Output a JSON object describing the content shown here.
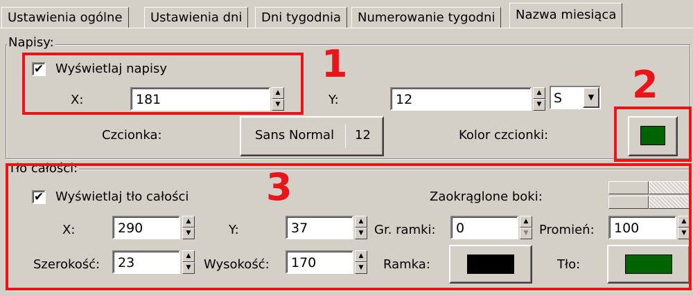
{
  "tabs": [
    {
      "label": "Ustawienia ogólne",
      "active": false
    },
    {
      "label": "Ustawienia dni",
      "active": false
    },
    {
      "label": "Dni tygodnia",
      "active": false
    },
    {
      "label": "Numerowanie tygodni",
      "active": false
    },
    {
      "label": "Nazwa miesiąca",
      "active": true
    }
  ],
  "napisy": {
    "group_title": "Napisy:",
    "show_label": "Wyświetlaj napisy",
    "show_checked": true,
    "x_label": "X:",
    "x_value": "181",
    "y_label": "Y:",
    "y_value": "12",
    "anchor_value": "S",
    "font_label": "Czcionka:",
    "font_name": "Sans Normal",
    "font_size": "12",
    "font_color_label": "Kolor czcionki:",
    "font_color": "#006400"
  },
  "tlo": {
    "group_title": "Tło całości:",
    "show_label": "Wyświetlaj tło całości",
    "show_checked": true,
    "x_label": "X:",
    "x_value": "290",
    "y_label": "Y:",
    "y_value": "37",
    "border_width_label": "Gr. ramki:",
    "border_width_value": "0",
    "radius_label": "Promień:",
    "radius_value": "100",
    "rounded_label": "Zaokrąglone boki:",
    "width_label": "Szerokość:",
    "width_value": "23",
    "height_label": "Wysokość:",
    "height_value": "170",
    "frame_label": "Ramka:",
    "frame_color": "#000000",
    "bg_label": "Tło:",
    "bg_color": "#006400"
  },
  "annotations": [
    "1",
    "2",
    "3"
  ],
  "colors": {
    "annotation": "#e8151b",
    "dialog_bg": "#d4d0c8"
  },
  "icons": {
    "check": "✔",
    "spin_up": "▲",
    "spin_down": "▼",
    "dropdown": "▼"
  }
}
